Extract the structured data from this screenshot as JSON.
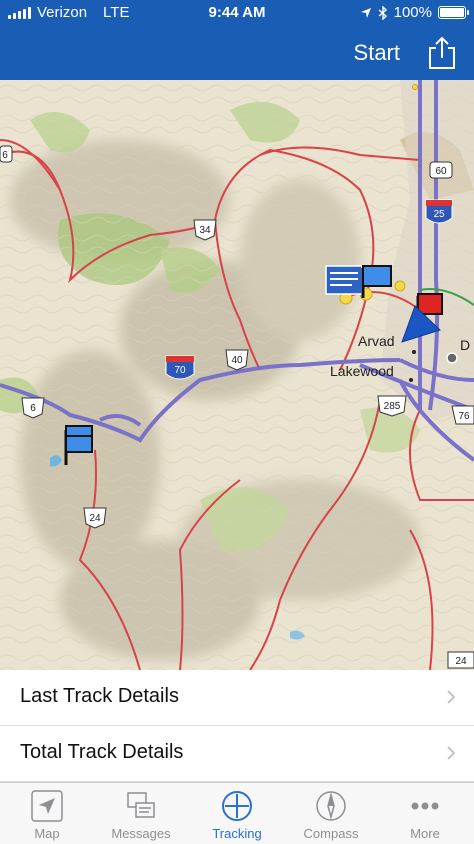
{
  "status": {
    "carrier": "Verizon",
    "network": "LTE",
    "time": "9:44 AM",
    "battery": "100%"
  },
  "nav": {
    "start_label": "Start",
    "share_icon": "share-icon"
  },
  "map": {
    "places": {
      "arvada": "Arvad",
      "lakewood": "Lakewood",
      "denver_partial": "D"
    },
    "shields": {
      "us6_left": "6",
      "us6_top": "6",
      "co34": "34",
      "us40": "40",
      "i70": "70",
      "us285": "285",
      "co93": "24",
      "us24": "24",
      "i25": "25",
      "co72": "60",
      "i76": "76"
    }
  },
  "list": {
    "last_track": "Last Track Details",
    "total_track": "Total Track Details"
  },
  "tabs": [
    {
      "label": "Map",
      "icon": "map-pointer-icon",
      "active": false
    },
    {
      "label": "Messages",
      "icon": "messages-icon",
      "active": false
    },
    {
      "label": "Tracking",
      "icon": "tracking-crosshair-icon",
      "active": true
    },
    {
      "label": "Compass",
      "icon": "compass-icon",
      "active": false
    },
    {
      "label": "More",
      "icon": "more-icon",
      "active": false
    }
  ],
  "colors": {
    "brand": "#1a5db4",
    "tab_active": "#2b6fd1",
    "tab_inactive": "#8e8e93"
  }
}
